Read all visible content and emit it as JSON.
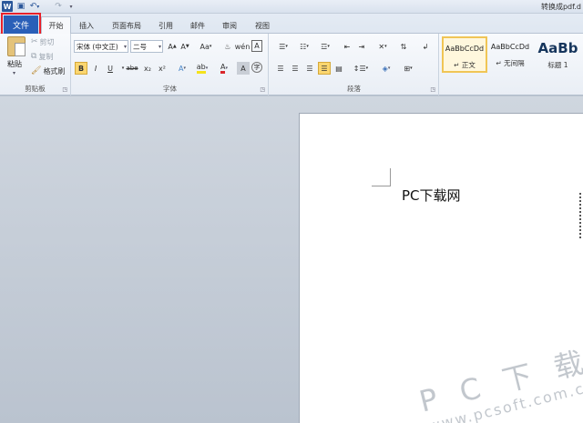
{
  "title_bar": {
    "app_icon": "W",
    "doc_title": "转换成pdf.d",
    "icons": [
      "word-logo",
      "save-icon",
      "undo-icon",
      "redo-icon",
      "customize-arrow-icon"
    ]
  },
  "tabs": {
    "file": "文件",
    "items": [
      "开始",
      "插入",
      "页面布局",
      "引用",
      "邮件",
      "审阅",
      "视图"
    ]
  },
  "clipboard": {
    "paste": "粘贴",
    "cut": "剪切",
    "copy": "复制",
    "format_painter": "格式刷",
    "label": "剪贴板"
  },
  "font": {
    "font_name": "宋体 (中文正)",
    "font_size": "二号",
    "case_label": "Aa",
    "bold": "B",
    "italic": "I",
    "underline": "U",
    "strike": "abe",
    "subscript": "x₂",
    "superscript": "x²",
    "label": "字体",
    "highlight_color": "#f5e21b",
    "font_color": "#d9262b"
  },
  "paragraph": {
    "label": "段落"
  },
  "styles": {
    "items": [
      {
        "sample": "AaBbCcDd",
        "name": "↵ 正文"
      },
      {
        "sample": "AaBbCcDd",
        "name": "↵ 无间隔"
      },
      {
        "sample": "AaBb",
        "name": "标题 1"
      }
    ]
  },
  "document": {
    "body_text": "PC下载网"
  },
  "watermark": {
    "line1": "P C 下 载 网",
    "line2": "www.pcsoft.com.cn"
  }
}
